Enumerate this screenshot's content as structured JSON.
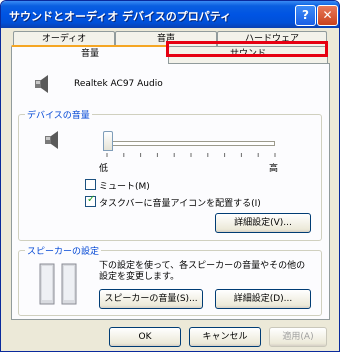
{
  "window": {
    "title": "サウンドとオーディオ デバイスのプロパティ",
    "help_label": "?",
    "close_label": "✕"
  },
  "tabs_back": [
    {
      "label": "オーディオ"
    },
    {
      "label": "音声"
    },
    {
      "label": "ハードウェア"
    }
  ],
  "tabs_front": [
    {
      "label": "音量"
    },
    {
      "label": "サウンド"
    }
  ],
  "device": {
    "name": "Realtek AC97 Audio"
  },
  "device_volume": {
    "group_label": "デバイスの音量",
    "slider_low": "低",
    "slider_high": "高",
    "slider_value": 0.0,
    "mute_label": "ミュート(M)",
    "mute_checked": false,
    "taskbar_icon_label": "タスクバーに音量アイコンを配置する(I)",
    "taskbar_icon_checked": true,
    "advanced_button": "詳細設定(V)..."
  },
  "speaker": {
    "group_label": "スピーカーの設定",
    "description": "下の設定を使って、各スピーカーの音量やその他の設定を変更します。",
    "volume_button": "スピーカーの音量(S)...",
    "advanced_button": "詳細設定(D)..."
  },
  "footer": {
    "ok": "OK",
    "cancel": "キャンセル",
    "apply": "適用(A)"
  },
  "colors": {
    "title_bar": "#0054e3",
    "group_label": "#0046d5",
    "highlight": "#e60012",
    "check": "#21a121"
  }
}
